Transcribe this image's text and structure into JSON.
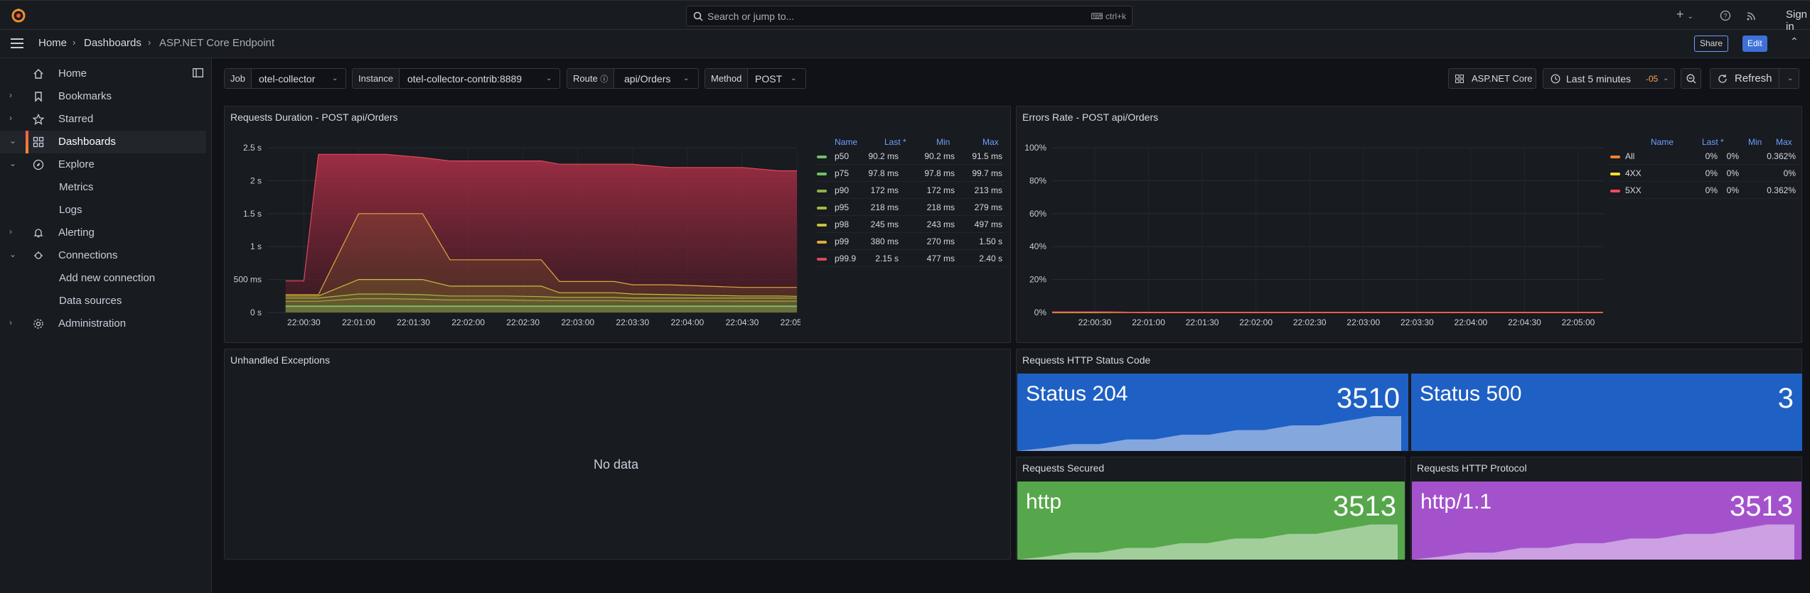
{
  "topbar": {
    "search_placeholder": "Search or jump to...",
    "search_shortcut": "ctrl+k",
    "plus": "+",
    "signin": "Sign in"
  },
  "breadcrumb": {
    "home": "Home",
    "dashboards": "Dashboards",
    "current": "ASP.NET Core Endpoint"
  },
  "actions": {
    "share": "Share",
    "edit": "Edit"
  },
  "sidebar": {
    "items": [
      {
        "label": "Home"
      },
      {
        "label": "Bookmarks"
      },
      {
        "label": "Starred"
      },
      {
        "label": "Dashboards"
      },
      {
        "label": "Explore"
      },
      {
        "label": "Metrics"
      },
      {
        "label": "Logs"
      },
      {
        "label": "Alerting"
      },
      {
        "label": "Connections"
      },
      {
        "label": "Add new connection"
      },
      {
        "label": "Data sources"
      },
      {
        "label": "Administration"
      }
    ]
  },
  "variables": {
    "job": {
      "key": "Job",
      "value": "otel-collector"
    },
    "instance": {
      "key": "Instance",
      "value": "otel-collector-contrib:8889"
    },
    "route": {
      "key": "Route",
      "value": "api/Orders"
    },
    "method": {
      "key": "Method",
      "value": "POST"
    }
  },
  "toolbar": {
    "dash_link": "ASP.NET Core",
    "time_range": "Last 5 minutes",
    "tz": "-05",
    "refresh": "Refresh"
  },
  "panels": {
    "duration": {
      "title": "Requests Duration - POST api/Orders",
      "legend_headers": [
        "Name",
        "Last *",
        "Min",
        "Max"
      ],
      "legend": [
        {
          "name": "p50",
          "last": "90.2 ms",
          "min": "90.2 ms",
          "max": "91.5 ms",
          "color": "#73bf69"
        },
        {
          "name": "p75",
          "last": "97.8 ms",
          "min": "97.8 ms",
          "max": "99.7 ms",
          "color": "#73bf69"
        },
        {
          "name": "p90",
          "last": "172 ms",
          "min": "172 ms",
          "max": "213 ms",
          "color": "#8ab34a"
        },
        {
          "name": "p95",
          "last": "218 ms",
          "min": "218 ms",
          "max": "279 ms",
          "color": "#a8b83e"
        },
        {
          "name": "p98",
          "last": "245 ms",
          "min": "243 ms",
          "max": "497 ms",
          "color": "#c4c23d"
        },
        {
          "name": "p99",
          "last": "380 ms",
          "min": "270 ms",
          "max": "1.50 s",
          "color": "#e0a83c"
        },
        {
          "name": "p99.9",
          "last": "2.15 s",
          "min": "477 ms",
          "max": "2.40 s",
          "color": "#e0475a"
        }
      ]
    },
    "errors": {
      "title": "Errors Rate - POST api/Orders",
      "legend_headers": [
        "Name",
        "Last *",
        "Min",
        "Max"
      ],
      "legend": [
        {
          "name": "All",
          "last": "0%",
          "min": "0%",
          "max": "0.362%",
          "color": "#ff7f2a"
        },
        {
          "name": "4XX",
          "last": "0%",
          "min": "0%",
          "max": "0%",
          "color": "#fade2a"
        },
        {
          "name": "5XX",
          "last": "0%",
          "min": "0%",
          "max": "0.362%",
          "color": "#f2495c"
        }
      ]
    },
    "exceptions": {
      "title": "Unhandled Exceptions",
      "empty": "No data"
    },
    "status": {
      "title": "Requests HTTP Status Code",
      "s1_name": "Status 204",
      "s1_value": "3510",
      "s2_name": "Status 500",
      "s2_value": "3"
    },
    "secured": {
      "title": "Requests Secured",
      "name": "http",
      "value": "3513"
    },
    "protocol": {
      "title": "Requests HTTP Protocol",
      "name": "http/1.1",
      "value": "3513"
    }
  },
  "chart_data": [
    {
      "type": "area",
      "title": "Requests Duration - POST api/Orders",
      "x": [
        "22:00:20",
        "22:00:30",
        "22:00:38",
        "22:01:00",
        "22:01:15",
        "22:01:35",
        "22:01:50",
        "22:02:20",
        "22:02:40",
        "22:02:50",
        "22:03:20",
        "22:03:30",
        "22:03:50",
        "22:04:30",
        "22:04:50",
        "22:05:00"
      ],
      "x_ticks": [
        "22:00:30",
        "22:01:00",
        "22:01:30",
        "22:02:00",
        "22:02:30",
        "22:03:00",
        "22:03:30",
        "22:04:00",
        "22:04:30",
        "22:05:00"
      ],
      "y_ticks": [
        "0 s",
        "500 ms",
        "1 s",
        "1.5 s",
        "2 s",
        "2.5 s"
      ],
      "ylim": [
        0,
        2.5
      ],
      "yunit": "s",
      "series": [
        {
          "name": "p99.9",
          "values": [
            0.48,
            0.48,
            2.4,
            2.4,
            2.4,
            2.35,
            2.3,
            2.3,
            2.3,
            2.25,
            2.25,
            2.25,
            2.2,
            2.2,
            2.15,
            2.15
          ]
        },
        {
          "name": "p99",
          "values": [
            0.27,
            0.27,
            0.27,
            1.5,
            1.5,
            1.5,
            0.8,
            0.8,
            0.8,
            0.47,
            0.47,
            0.42,
            0.42,
            0.38,
            0.38,
            0.38
          ]
        },
        {
          "name": "p98",
          "values": [
            0.25,
            0.25,
            0.25,
            0.5,
            0.5,
            0.5,
            0.4,
            0.4,
            0.4,
            0.3,
            0.3,
            0.28,
            0.27,
            0.25,
            0.25,
            0.245
          ]
        },
        {
          "name": "p95",
          "values": [
            0.22,
            0.22,
            0.22,
            0.28,
            0.28,
            0.27,
            0.25,
            0.25,
            0.24,
            0.23,
            0.23,
            0.22,
            0.22,
            0.22,
            0.22,
            0.218
          ]
        },
        {
          "name": "p90",
          "values": [
            0.17,
            0.17,
            0.17,
            0.21,
            0.21,
            0.2,
            0.19,
            0.19,
            0.18,
            0.18,
            0.18,
            0.175,
            0.175,
            0.172,
            0.172,
            0.172
          ]
        },
        {
          "name": "p75",
          "values": [
            0.098,
            0.098,
            0.098,
            0.0997,
            0.0997,
            0.099,
            0.099,
            0.099,
            0.098,
            0.098,
            0.098,
            0.098,
            0.098,
            0.098,
            0.098,
            0.098
          ]
        },
        {
          "name": "p50",
          "values": [
            0.09,
            0.09,
            0.09,
            0.0915,
            0.0915,
            0.091,
            0.091,
            0.091,
            0.0905,
            0.0905,
            0.0902,
            0.0902,
            0.0902,
            0.0902,
            0.0902,
            0.0902
          ]
        }
      ]
    },
    {
      "type": "line",
      "title": "Errors Rate - POST api/Orders",
      "x_ticks": [
        "22:00:30",
        "22:01:00",
        "22:01:30",
        "22:02:00",
        "22:02:30",
        "22:03:00",
        "22:03:30",
        "22:04:00",
        "22:04:30",
        "22:05:00"
      ],
      "y_ticks": [
        "0%",
        "20%",
        "40%",
        "60%",
        "80%",
        "100%"
      ],
      "ylim": [
        0,
        100
      ],
      "series": [
        {
          "name": "All",
          "values": [
            0.362,
            0,
            0,
            0,
            0,
            0,
            0,
            0,
            0,
            0
          ]
        },
        {
          "name": "4XX",
          "values": [
            0,
            0,
            0,
            0,
            0,
            0,
            0,
            0,
            0,
            0
          ]
        },
        {
          "name": "5XX",
          "values": [
            0.362,
            0,
            0,
            0,
            0,
            0,
            0,
            0,
            0,
            0
          ]
        }
      ]
    }
  ],
  "colors": {
    "accent": "#f55f3e",
    "blue": "#3d71d9",
    "stat_blue": "#1f60c4",
    "stat_green": "#56a64b",
    "stat_purple": "#a352cc"
  }
}
